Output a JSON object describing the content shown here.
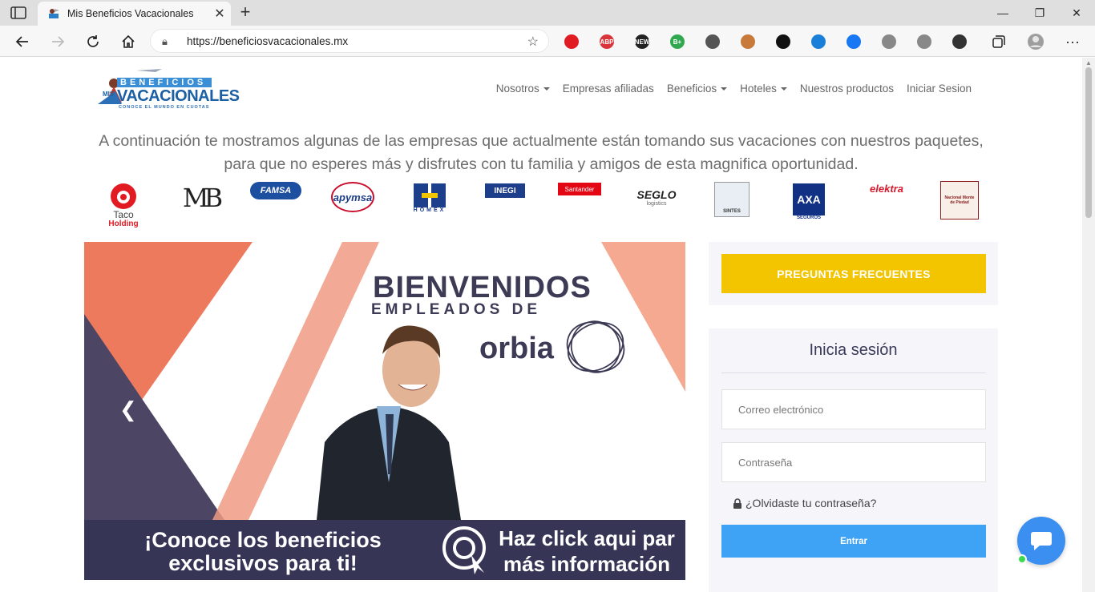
{
  "browser": {
    "tab_title": "Mis Beneficios Vacacionales",
    "url": "https://beneficiosvacacionales.mx",
    "extensions": [
      {
        "name": "stop-icon",
        "color": "#e01b22",
        "label": ""
      },
      {
        "name": "abp-icon",
        "color": "#d9353b",
        "label": "ABP"
      },
      {
        "name": "news-icon",
        "color": "#222222",
        "label": "NEW"
      },
      {
        "name": "bplus-icon",
        "color": "#2fa84f",
        "label": "B+"
      },
      {
        "name": "code-icon",
        "color": "#555555",
        "label": ""
      },
      {
        "name": "hammer-icon",
        "color": "#c87a3a",
        "label": ""
      },
      {
        "name": "foot-icon",
        "color": "#111111",
        "label": ""
      },
      {
        "name": "screen-icon",
        "color": "#1a7fd8",
        "label": ""
      },
      {
        "name": "check-icon",
        "color": "#1877f2",
        "label": ""
      },
      {
        "name": "vee-icon",
        "color": "#888888",
        "label": ""
      },
      {
        "name": "vee2-icon",
        "color": "#888888",
        "label": ""
      },
      {
        "name": "puzzle-icon",
        "color": "#333333",
        "label": ""
      }
    ]
  },
  "site": {
    "logo_top": "BENEFICIOS",
    "logo_mis": "MIS",
    "logo_main": "VACACIONALES",
    "logo_tagline": "CONOCE EL MUNDO EN CUOTAS",
    "nav": [
      {
        "label": "Nosotros",
        "dropdown": true
      },
      {
        "label": "Empresas afiliadas",
        "dropdown": false
      },
      {
        "label": "Beneficios",
        "dropdown": true
      },
      {
        "label": "Hoteles",
        "dropdown": true
      },
      {
        "label": "Nuestros productos",
        "dropdown": false
      },
      {
        "label": "Iniciar Sesion",
        "dropdown": false
      }
    ],
    "intro": "A continuación te mostramos algunas de las empresas que actualmente están tomando sus vacaciones con nuestros paquetes, para que no esperes más y disfrutes con tu familia y amigos de esta magnifica oportunidad.",
    "clients": [
      {
        "name": "Taco Holding",
        "line1": "Taco",
        "line2": "Holding"
      },
      {
        "name": "MB",
        "line1": "MB",
        "line2": ""
      },
      {
        "name": "Famsa",
        "line1": "FAMSA",
        "line2": ""
      },
      {
        "name": "Apymsa",
        "line1": "apymsa",
        "line2": ""
      },
      {
        "name": "Homex",
        "line1": "HOMEX",
        "line2": ""
      },
      {
        "name": "INEGI",
        "line1": "INEGI",
        "line2": ""
      },
      {
        "name": "Santander",
        "line1": "Santander",
        "line2": ""
      },
      {
        "name": "Seglo",
        "line1": "SEGLO",
        "line2": "logistics"
      },
      {
        "name": "Sintes",
        "line1": "SINTES",
        "line2": ""
      },
      {
        "name": "AXA",
        "line1": "AXA",
        "line2": "SEGUROS"
      },
      {
        "name": "Elektra",
        "line1": "elektra",
        "line2": ""
      },
      {
        "name": "Nacional Monte de Piedad",
        "line1": "Nacional Monte de Piedad",
        "line2": ""
      }
    ]
  },
  "banner": {
    "title": "BIENVENIDOS",
    "subtitle": "EMPLEADOS DE",
    "company": "orbia",
    "left_text_1": "¡Conoce los beneficios",
    "left_text_2": "exclusivos para ti!",
    "right_text_1": "Haz click aqui par",
    "right_text_2": "más información"
  },
  "sidebar": {
    "faq_label": "PREGUNTAS FRECUENTES",
    "login_title": "Inicia sesión",
    "email_placeholder": "Correo electrónico",
    "password_placeholder": "Contraseña",
    "forgot_label": "¿Olvidaste tu contraseña?",
    "submit_label": "Entrar"
  },
  "colors": {
    "accent_yellow": "#f2c500",
    "accent_blue": "#3ea3f5",
    "banner_dark": "#373556",
    "banner_salmon": "#ee7a5e"
  }
}
